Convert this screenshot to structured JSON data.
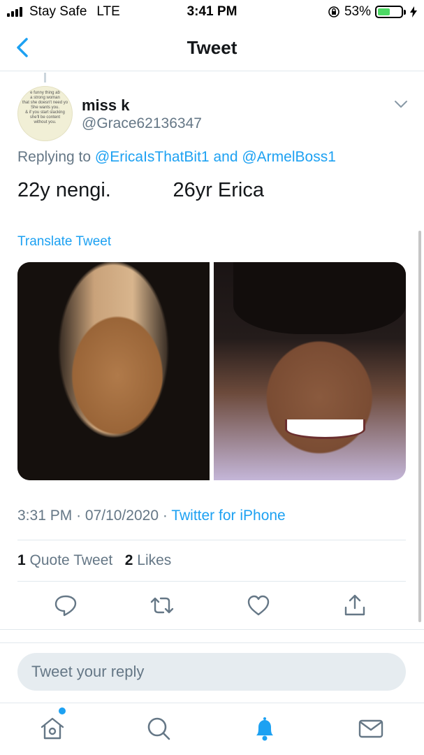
{
  "status_bar": {
    "carrier": "Stay Safe",
    "network": "LTE",
    "time": "3:41 PM",
    "battery": "53%",
    "battery_level": 0.53,
    "battery_color": "#4cd964"
  },
  "nav": {
    "title": "Tweet",
    "back_icon": "chevron-left-icon"
  },
  "tweet": {
    "avatar_text": [
      "e funny thing ab",
      "a strong woman",
      "that she doesn't need yo",
      "She wants you.",
      "& if you start slacking",
      "she'll be content",
      "without you."
    ],
    "name": "miss k",
    "handle": "@Grace62136347",
    "replying_prefix": "Replying to",
    "reply_user_1": "@EricaIsThatBit1",
    "reply_and": "and",
    "reply_user_2": "@ArmelBoss1",
    "text": "22y nengi.           26yr Erica",
    "translate": "Translate Tweet",
    "time": "3:31 PM",
    "date": "07/10/2020",
    "source": "Twitter for iPhone",
    "separator": "·",
    "quote_count": "1",
    "quote_label": "Quote Tweet",
    "like_count": "2",
    "like_label": "Likes"
  },
  "actions": [
    "reply-icon",
    "retweet-icon",
    "like-icon",
    "share-icon"
  ],
  "reply": {
    "placeholder": "Tweet your reply"
  },
  "tabs": [
    "home-icon",
    "search-icon",
    "notifications-icon",
    "messages-icon"
  ],
  "colors": {
    "accent": "#1da1f2",
    "secondary_text": "#657786",
    "border": "#e1e8ed"
  }
}
